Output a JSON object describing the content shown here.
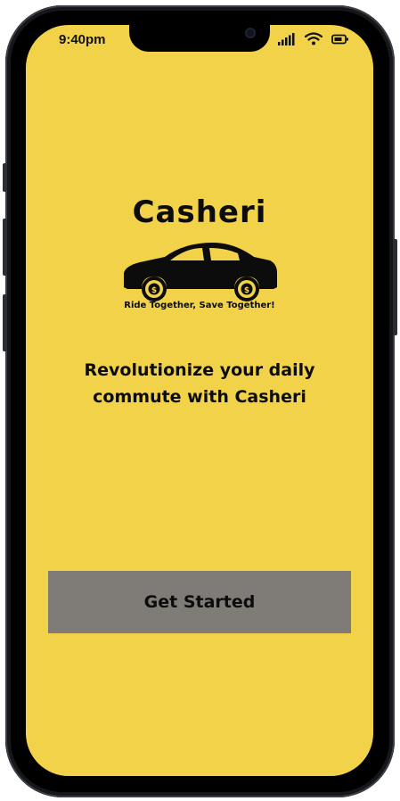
{
  "status_bar": {
    "time": "9:40pm",
    "signal_icon": "cellular-signal-icon",
    "wifi_icon": "wifi-icon",
    "battery_icon": "battery-icon"
  },
  "brand": {
    "name": "Casheri",
    "tagline": "Ride Together, Save Together!",
    "logo_icon": "car-icon",
    "wheel_icon": "dollar-coin-icon"
  },
  "headline": "Revolutionize your daily commute with Casheri",
  "cta": {
    "label": "Get Started"
  },
  "colors": {
    "background": "#f2d248",
    "button": "#7f7c78",
    "text": "#0c0c0c"
  }
}
